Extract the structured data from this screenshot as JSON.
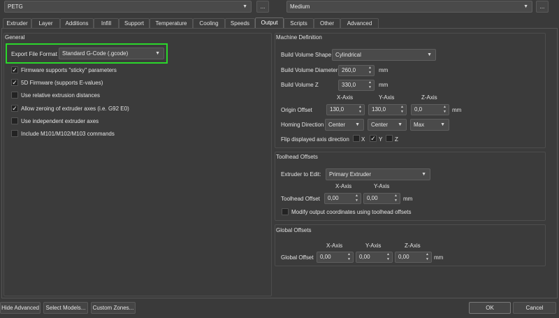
{
  "top": {
    "material": "PETG",
    "material_more": "...",
    "quality": "Medium",
    "quality_more": "..."
  },
  "tabs": [
    "Extruder",
    "Layer",
    "Additions",
    "Infill",
    "Support",
    "Temperature",
    "Cooling",
    "Speeds",
    "Output",
    "Scripts",
    "Other",
    "Advanced"
  ],
  "active_tab": "Output",
  "general": {
    "title": "General",
    "export_label": "Export File Format",
    "export_value": "Standard G-Code (.gcode)",
    "checkboxes": [
      {
        "label": "Firmware supports \"sticky\" parameters",
        "checked": true
      },
      {
        "label": "5D Firmware (supports E-values)",
        "checked": true
      },
      {
        "label": "Use relative extrusion distances",
        "checked": false
      },
      {
        "label": "Allow zeroing of extruder axes (i.e. G92 E0)",
        "checked": true
      },
      {
        "label": "Use independent extruder axes",
        "checked": false
      },
      {
        "label": "Include M101/M102/M103 commands",
        "checked": false
      }
    ]
  },
  "machine": {
    "title": "Machine Definition",
    "shape_label": "Build Volume Shape",
    "shape_value": "Cylindrical",
    "diameter_label": "Build Volume Diameter",
    "diameter_value": "260,0",
    "diameter_unit": "mm",
    "z_label": "Build Volume Z",
    "z_value": "330,0",
    "z_unit": "mm",
    "axis_x": "X-Axis",
    "axis_y": "Y-Axis",
    "axis_z": "Z-Axis",
    "origin_label": "Origin Offset",
    "origin_x": "130,0",
    "origin_y": "130,0",
    "origin_z": "0,0",
    "origin_unit": "mm",
    "homing_label": "Homing Direction",
    "homing_x": "Center",
    "homing_y": "Center",
    "homing_z": "Max",
    "flip_label": "Flip displayed axis direction",
    "flip_x_label": "X",
    "flip_y_label": "Y",
    "flip_z_label": "Z",
    "flip_x": false,
    "flip_y": true,
    "flip_z": false
  },
  "toolhead": {
    "title": "Toolhead Offsets",
    "extruder_label": "Extruder to Edit:",
    "extruder_value": "Primary Extruder",
    "axis_x": "X-Axis",
    "axis_y": "Y-Axis",
    "offset_label": "Toolhead Offset",
    "offset_x": "0,00",
    "offset_y": "0,00",
    "unit": "mm",
    "modify_label": "Modify output coordinates using toolhead offsets",
    "modify_checked": false
  },
  "global": {
    "title": "Global Offsets",
    "axis_x": "X-Axis",
    "axis_y": "Y-Axis",
    "axis_z": "Z-Axis",
    "offset_label": "Global Offset",
    "x": "0,00",
    "y": "0,00",
    "z": "0,00",
    "unit": "mm"
  },
  "footer": {
    "hide_advanced": "Hide Advanced",
    "select_models": "Select Models...",
    "custom_zones": "Custom Zones...",
    "ok": "OK",
    "cancel": "Cancel"
  },
  "colors": {
    "highlight": "#2bd72b",
    "background": "#3a3a3a"
  }
}
